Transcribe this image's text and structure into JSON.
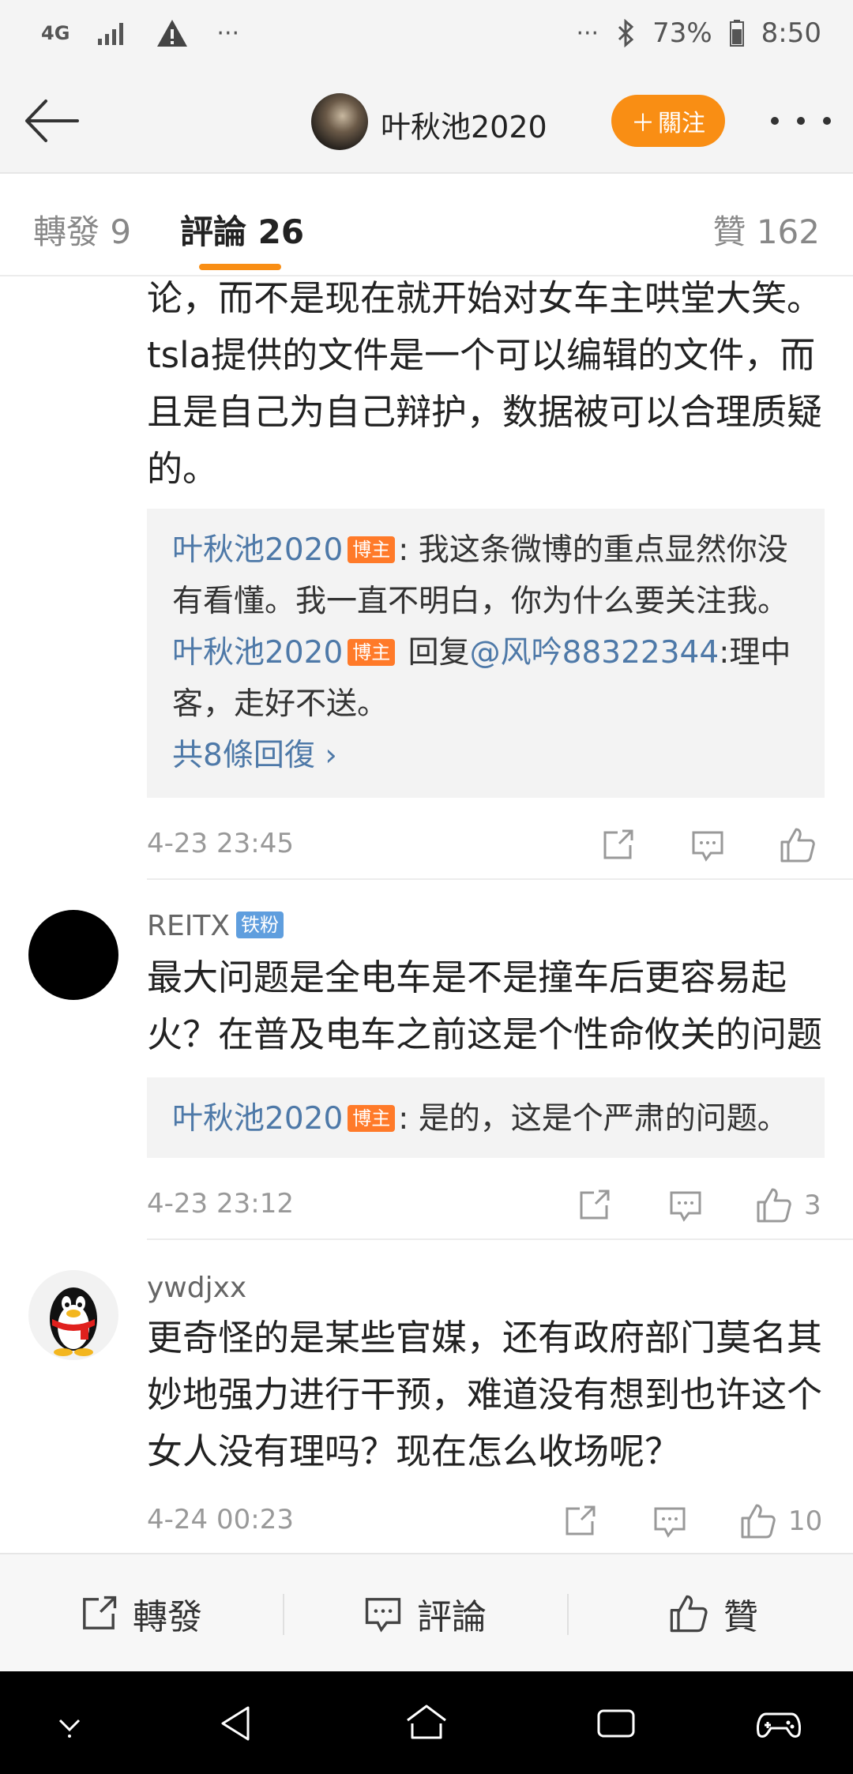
{
  "status_bar": {
    "network": "4G",
    "battery": "73%",
    "time": "8:50"
  },
  "header": {
    "user_name": "叶秋池2020",
    "follow_label": "關注"
  },
  "tabs": {
    "repost": "轉發 9",
    "comments": "評論 26",
    "likes": "贊 162"
  },
  "post_cont": {
    "lines": [
      "论，而不是现在就开始对女车主哄堂大笑。",
      "tsla提供的文件是一个可以编辑的文件，而",
      "且是自己为自己辩护，数据被可以合理质疑",
      "的。"
    ],
    "reply_author": "叶秋池2020",
    "host_badge": "博主",
    "reply1_text": ": 我这条微博的重点显然你没有看懂。我一直不明白，你为什么要关注我。",
    "reply2_prefix": " 回复",
    "reply2_mention": "@风吟88322344",
    "reply2_text": ":理中客，走好不送。",
    "more_replies": "共8條回復 ›",
    "timestamp": "4-23 23:45"
  },
  "comments": [
    {
      "username": "REITX",
      "fan_badge": "铁粉",
      "text_lines": [
        "最大问题是全电车是不是撞车后更容易起",
        "火？在普及电车之前这是个性命攸关的问题"
      ],
      "reply_author": "叶秋池2020",
      "host_badge": "博主",
      "reply_text": ": 是的，这是个严肃的问题。",
      "timestamp": "4-23 23:12",
      "likes": "3"
    },
    {
      "username": "ywdjxx",
      "text_lines": [
        "更奇怪的是某些官媒，还有政府部门莫名其",
        "妙地强力进行干预，难道没有想到也许这个",
        "女人没有理吗？现在怎么收场呢？"
      ],
      "timestamp": "4-24 00:23",
      "likes": "10"
    }
  ],
  "bottom_bar": {
    "repost": "轉發",
    "comment": "評論",
    "like": "贊"
  },
  "colors": {
    "accent": "#f98e14",
    "link": "#4e79a8",
    "host_badge": "#ff7a29",
    "fan_badge": "#5f9ede"
  },
  "icons": [
    "back-arrow-icon",
    "more-icon",
    "share-icon",
    "comment-icon",
    "like-icon",
    "home-icon",
    "recents-icon",
    "game-icon"
  ]
}
